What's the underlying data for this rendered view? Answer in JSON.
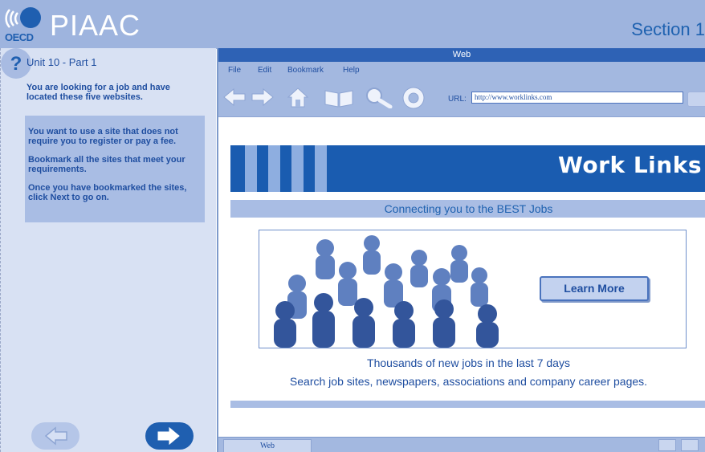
{
  "header": {
    "logo_text": "OECD",
    "title": "PIAAC",
    "section": "Section 1"
  },
  "left_panel": {
    "unit": "Unit 10 - Part 1",
    "intro": "You are looking for a job and have located these five websites.",
    "instructions": [
      "You want to use a site that does not require you to register or pay a fee.",
      "Bookmark all the sites that meet your requirements.",
      "Once you have bookmarked the sites, click Next to go on."
    ],
    "nav": {
      "back_icon": "arrow-left-icon",
      "help_icon": "question-icon",
      "next_icon": "arrow-right-icon"
    }
  },
  "browser": {
    "title": "Web",
    "menu": [
      "File",
      "Edit",
      "Bookmark",
      "Help"
    ],
    "toolbar_icons": [
      "back-icon",
      "forward-icon",
      "home-icon",
      "bookmarks-icon",
      "search-icon",
      "help-lifebuoy-icon"
    ],
    "url_label": "URL:",
    "url_value": "http://www.worklinks.com",
    "status_tab": "Web"
  },
  "site": {
    "banner_title": "Work Links",
    "tagline": "Connecting you to the BEST Jobs",
    "learn_more": "Learn More",
    "headline": "Thousands of new jobs in the last 7 days",
    "subline": "Search job sites, newspapers, associations and company career pages."
  },
  "colors": {
    "header_bg": "#9eb4de",
    "accent_blue": "#1a5cb0",
    "text_blue": "#1f4ea0",
    "panel_bg": "#d8e1f3"
  }
}
